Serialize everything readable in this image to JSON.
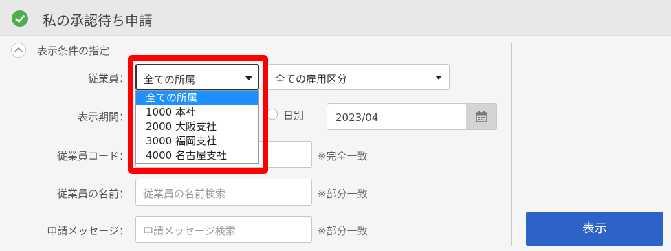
{
  "header": {
    "title": "私の承認待ち申請"
  },
  "filter_section": {
    "title": "表示条件の指定"
  },
  "employee": {
    "label": "従業員：",
    "affiliation_value": "全ての所属",
    "employment_value": "全ての雇用区分",
    "affiliation_options": [
      "全ての所属",
      "1000 本社",
      "2000 大阪支社",
      "3000 福岡支社",
      "4000 名古屋支社"
    ]
  },
  "period": {
    "label": "表示期間：",
    "radio_daily": "日別",
    "month_value": "2023/04"
  },
  "employee_code": {
    "label": "従業員コード：",
    "note": "※完全一致"
  },
  "employee_name": {
    "label": "従業員の名前：",
    "placeholder": "従業員の名前検索",
    "note": "※部分一致"
  },
  "request_message": {
    "label": "申請メッセージ：",
    "placeholder": "申請メッセージ検索",
    "note": "※部分一致"
  },
  "actions": {
    "show_label": "表示"
  }
}
